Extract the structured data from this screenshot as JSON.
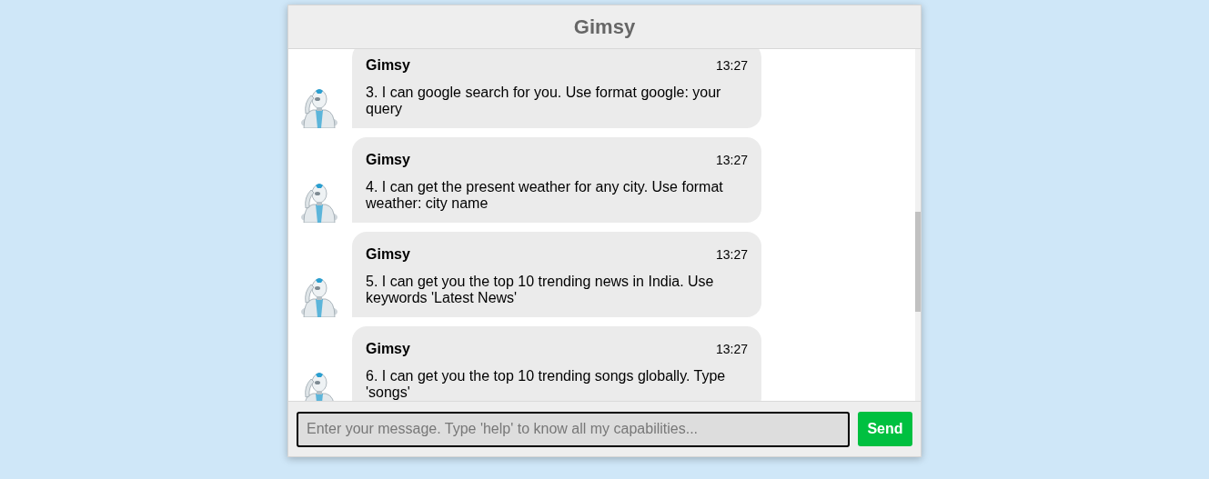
{
  "header": {
    "title": "Gimsy"
  },
  "messages": [
    {
      "sender": "Gimsy",
      "time": "13:27",
      "text": "3. I can google search for you. Use format google: your query"
    },
    {
      "sender": "Gimsy",
      "time": "13:27",
      "text": "4. I can get the present weather for any city. Use format weather: city name"
    },
    {
      "sender": "Gimsy",
      "time": "13:27",
      "text": "5. I can get you the top 10 trending news in India. Use keywords 'Latest News'"
    },
    {
      "sender": "Gimsy",
      "time": "13:27",
      "text": "6. I can get you the top 10 trending songs globally. Type 'songs'"
    }
  ],
  "composer": {
    "placeholder": "Enter your message. Type 'help' to know all my capabilities...",
    "send_label": "Send"
  }
}
